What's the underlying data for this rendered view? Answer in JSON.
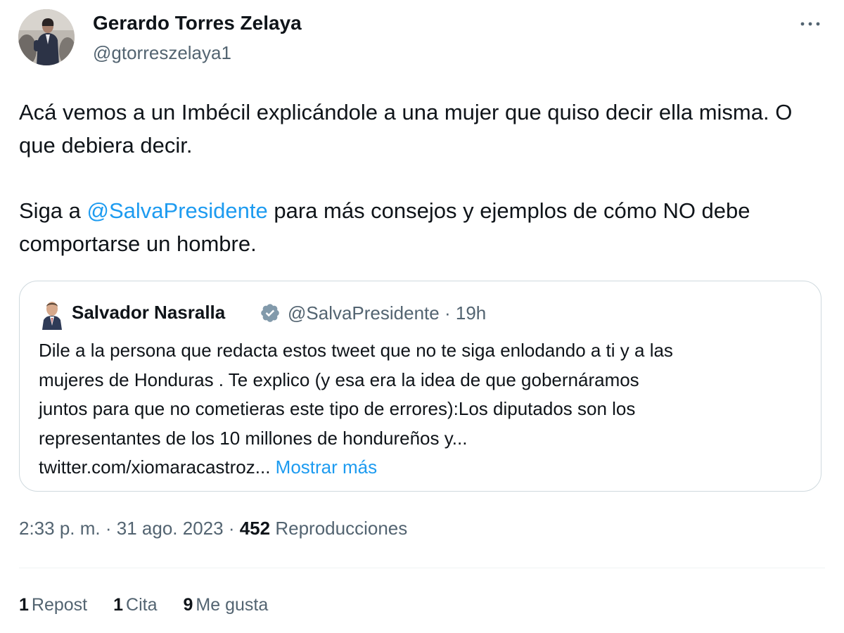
{
  "author": {
    "name": "Gerardo Torres Zelaya",
    "handle": "@gtorreszelaya1"
  },
  "tweet": {
    "paragraph1": "Acá vemos a un Imbécil explicándole a una mujer que quiso decir ella misma. O que debiera decir.",
    "paragraph2_before": "Siga a ",
    "paragraph2_mention": "@SalvaPresidente",
    "paragraph2_after": " para más consejos y ejemplos de cómo NO debe comportarse un hombre."
  },
  "quote": {
    "name": "Salvador Nasralla",
    "handle": "@SalvaPresidente",
    "separator": "·",
    "time": "19h",
    "lines": [
      "Dile a la persona que redacta estos tweet que no te siga enlodando a ti y a las",
      "mujeres de Honduras . Te explico (y esa era la idea de  que gobernáramos",
      "juntos para que no cometieras este tipo de errores):Los diputados son los",
      "representantes de los 10 millones de hondureños y...",
      "twitter.com/xiomaracastroz... "
    ],
    "show_more": "Mostrar más"
  },
  "meta": {
    "time": "2:33 p. m.",
    "separator": "·",
    "date": "31 ago. 2023",
    "views_count": "452",
    "views_label": "Reproducciones"
  },
  "stats": {
    "reposts_count": "1",
    "reposts_label": "Repost",
    "quotes_count": "1",
    "quotes_label": "Cita",
    "likes_count": "9",
    "likes_label": "Me gusta"
  },
  "colors": {
    "link": "#1d9bf0",
    "secondary_text": "#536471",
    "primary_text": "#0f1419",
    "border": "#cfd9de",
    "verified_badge": "#829aab"
  },
  "icons": {
    "more": "more-horizontal-icon",
    "verified": "verified-badge-icon"
  }
}
